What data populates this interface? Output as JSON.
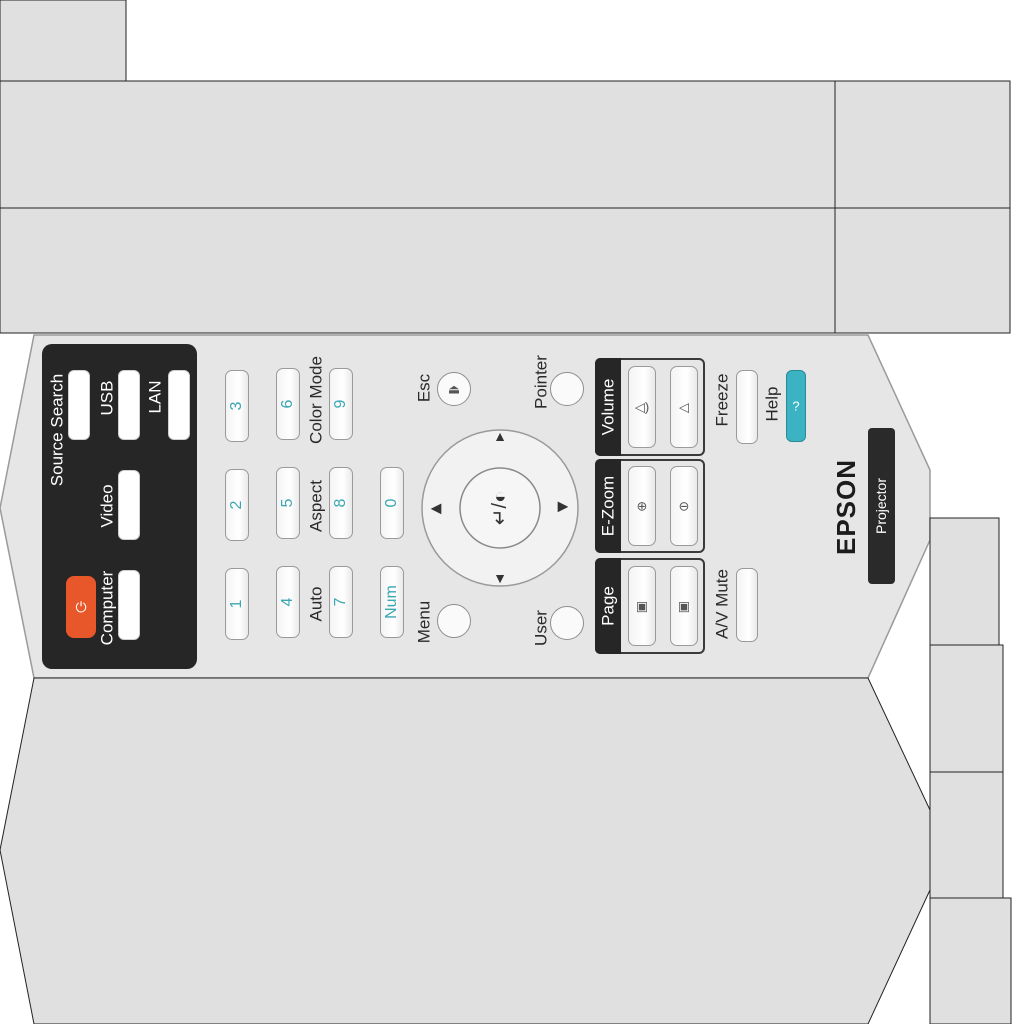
{
  "colors": {
    "background_panel": "#e0e0e0",
    "remote_body": "#e4e4e4",
    "dark_panel": "#2a2a2a",
    "power_button": "#e8572a",
    "help_button": "#3bb3c2",
    "digit_text": "#3aa7b3"
  },
  "source_panel": {
    "source_search_label": "Source Search",
    "usb_label": "USB",
    "lan_label": "LAN",
    "video_label": "Video",
    "computer_label": "Computer"
  },
  "numpad": {
    "d1": "1",
    "d2": "2",
    "d3": "3",
    "d4": "4",
    "d5": "5",
    "d6": "6",
    "d7": "7",
    "d8": "8",
    "d9": "9",
    "d0": "0",
    "num_label": "Num",
    "color_mode_label": "Color Mode",
    "aspect_label": "Aspect",
    "auto_label": "Auto"
  },
  "navigation": {
    "esc_label": "Esc",
    "menu_label": "Menu",
    "user_label": "User",
    "pointer_label": "Pointer"
  },
  "groups": {
    "volume_label": "Volume",
    "ezoom_label": "E-Zoom",
    "page_label": "Page",
    "freeze_label": "Freeze",
    "help_label": "Help",
    "av_mute_label": "A/V Mute"
  },
  "branding": {
    "brand_label": "EPSON",
    "product_label": "Projector"
  }
}
